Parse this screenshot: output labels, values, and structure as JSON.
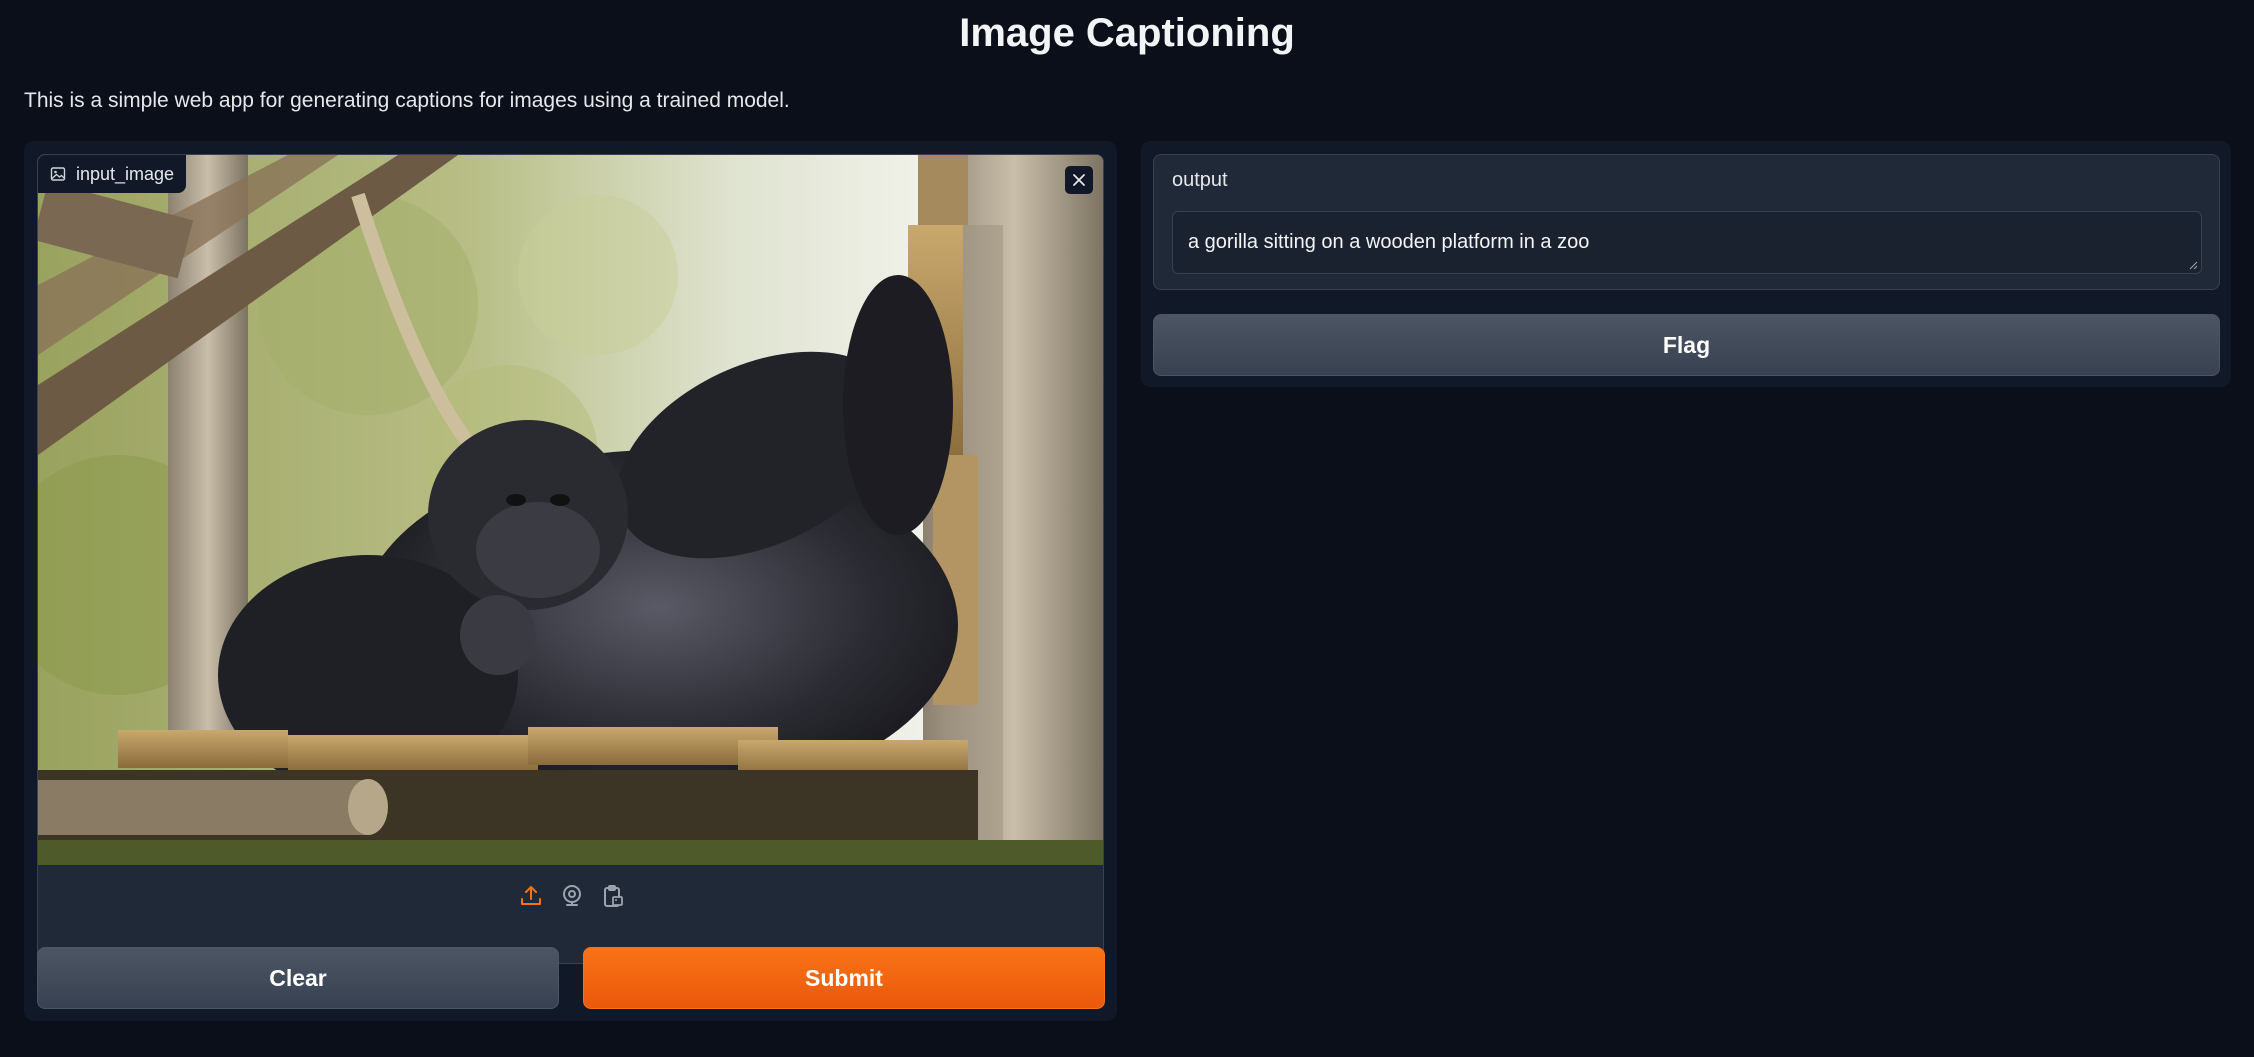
{
  "app": {
    "title": "Image Captioning",
    "description": "This is a simple web app for generating captions for images using a trained model."
  },
  "input": {
    "label": "input_image",
    "label_icon": "image-icon",
    "close_icon": "close-icon",
    "sources": [
      {
        "name": "upload",
        "icon": "upload-icon",
        "active": true
      },
      {
        "name": "webcam",
        "icon": "webcam-icon",
        "active": false
      },
      {
        "name": "clipboard",
        "icon": "clipboard-icon",
        "active": false
      }
    ]
  },
  "buttons": {
    "clear": "Clear",
    "submit": "Submit",
    "flag": "Flag"
  },
  "output": {
    "label": "output",
    "value": "a gorilla sitting on a wooden platform in a zoo"
  },
  "colors": {
    "background": "#0b0f19",
    "panel": "#111827",
    "block": "#1f2937",
    "accent": "#f97316",
    "secondary_button": "#4b5563"
  }
}
